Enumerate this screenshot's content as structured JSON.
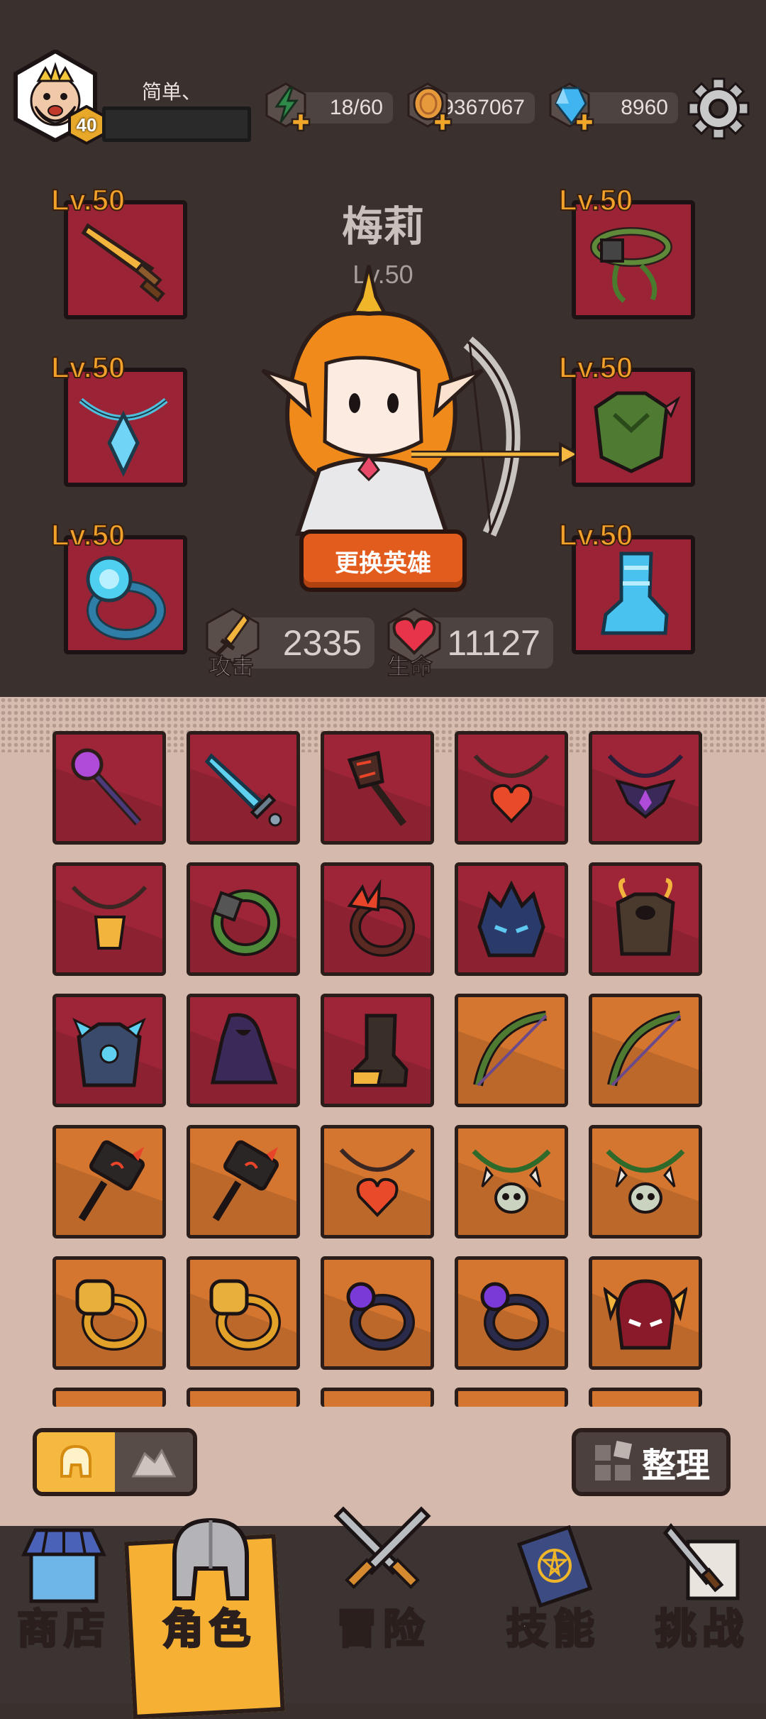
{
  "player": {
    "name": "简单、",
    "level": "40",
    "xp_progress": 0.0
  },
  "resources": {
    "energy": "18/60",
    "coins": "9367067",
    "gems": "8960"
  },
  "hero": {
    "name": "梅莉",
    "level": "Lv.50",
    "change_button": "更换英雄",
    "attack_label": "攻击",
    "attack_value": "2335",
    "hp_label": "生命",
    "hp_value": "11127"
  },
  "equipment": [
    {
      "slot": "weapon",
      "level": "Lv.50",
      "icon": "golden-sword-icon"
    },
    {
      "slot": "necklace",
      "level": "Lv.50",
      "icon": "crystal-necklace-icon"
    },
    {
      "slot": "ring",
      "level": "Lv.50",
      "icon": "spirit-ring-icon"
    },
    {
      "slot": "helmet",
      "level": "Lv.50",
      "icon": "vine-circlet-icon"
    },
    {
      "slot": "armor",
      "level": "Lv.50",
      "icon": "leaf-armor-icon"
    },
    {
      "slot": "boots",
      "level": "Lv.50",
      "icon": "ice-boots-icon"
    }
  ],
  "inventory": [
    {
      "icon": "orb-staff-icon",
      "rarity": "red"
    },
    {
      "icon": "ice-sword-icon",
      "rarity": "red"
    },
    {
      "icon": "lava-staff-icon",
      "rarity": "red"
    },
    {
      "icon": "heart-amulet-icon",
      "rarity": "red"
    },
    {
      "icon": "bat-amulet-icon",
      "rarity": "red"
    },
    {
      "icon": "gold-amulet-icon",
      "rarity": "red"
    },
    {
      "icon": "thorn-ring-icon",
      "rarity": "red"
    },
    {
      "icon": "flame-ring-icon",
      "rarity": "red"
    },
    {
      "icon": "demon-helm-icon",
      "rarity": "red"
    },
    {
      "icon": "horned-armor-icon",
      "rarity": "red"
    },
    {
      "icon": "crystal-armor-icon",
      "rarity": "red"
    },
    {
      "icon": "shadow-cloak-icon",
      "rarity": "red"
    },
    {
      "icon": "iron-boot-icon",
      "rarity": "red"
    },
    {
      "icon": "vine-bow-icon",
      "rarity": "orange"
    },
    {
      "icon": "vine-bow-icon",
      "rarity": "orange"
    },
    {
      "icon": "spiked-hammer-icon",
      "rarity": "orange"
    },
    {
      "icon": "spiked-hammer-icon",
      "rarity": "orange"
    },
    {
      "icon": "heart-amulet-icon",
      "rarity": "orange"
    },
    {
      "icon": "skull-necklace-icon",
      "rarity": "orange"
    },
    {
      "icon": "skull-necklace-icon",
      "rarity": "orange"
    },
    {
      "icon": "fist-ring-icon",
      "rarity": "orange"
    },
    {
      "icon": "fist-ring-icon",
      "rarity": "orange"
    },
    {
      "icon": "amethyst-ring-icon",
      "rarity": "orange"
    },
    {
      "icon": "amethyst-ring-icon",
      "rarity": "orange"
    },
    {
      "icon": "flame-helm-icon",
      "rarity": "orange"
    }
  ],
  "controls": {
    "sort_label": "整理"
  },
  "nav": {
    "shop": "商店",
    "character": "角色",
    "adventure": "冒险",
    "skills": "技能",
    "challenge": "挑战",
    "active": "character"
  },
  "colors": {
    "background": "#3a302e",
    "rarity_red": "#9e2538",
    "rarity_orange": "#d57630",
    "level_text": "#f2a12a",
    "active_tab": "#f6b134",
    "button_orange": "#e25c1e"
  }
}
